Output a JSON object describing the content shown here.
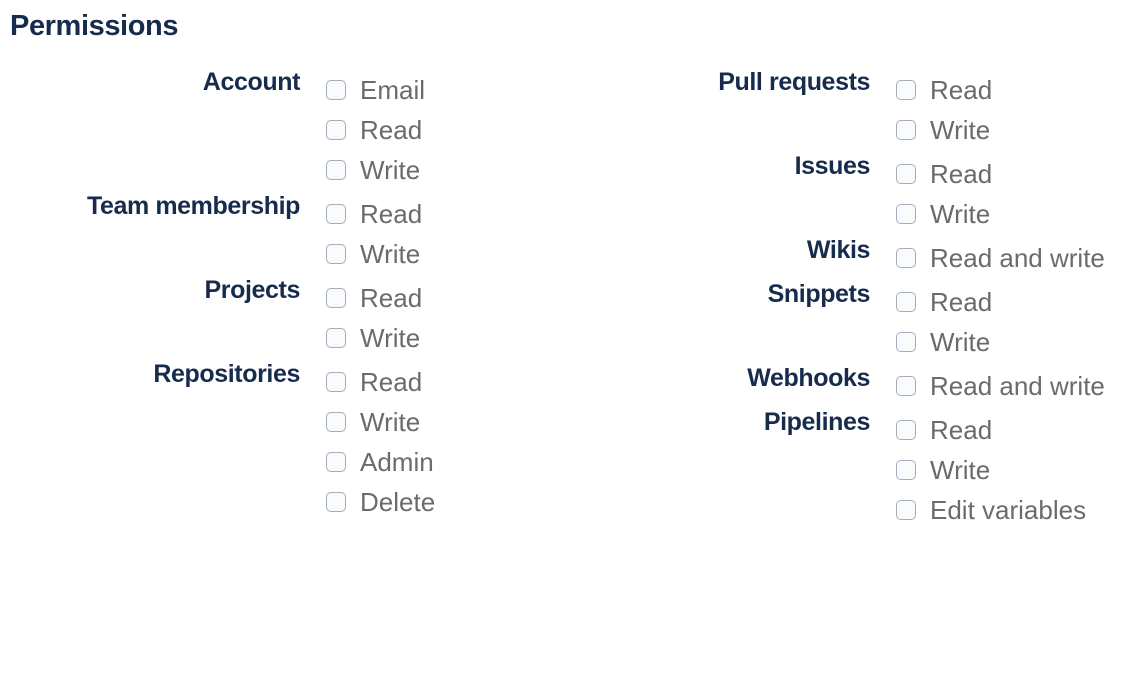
{
  "title": "Permissions",
  "left_groups": [
    {
      "label": "Account",
      "options": [
        "Email",
        "Read",
        "Write"
      ]
    },
    {
      "label": "Team membership",
      "options": [
        "Read",
        "Write"
      ]
    },
    {
      "label": "Projects",
      "options": [
        "Read",
        "Write"
      ]
    },
    {
      "label": "Repositories",
      "options": [
        "Read",
        "Write",
        "Admin",
        "Delete"
      ]
    }
  ],
  "right_groups": [
    {
      "label": "Pull requests",
      "options": [
        "Read",
        "Write"
      ]
    },
    {
      "label": "Issues",
      "options": [
        "Read",
        "Write"
      ]
    },
    {
      "label": "Wikis",
      "options": [
        "Read and write"
      ]
    },
    {
      "label": "Snippets",
      "options": [
        "Read",
        "Write"
      ]
    },
    {
      "label": "Webhooks",
      "options": [
        "Read and write"
      ]
    },
    {
      "label": "Pipelines",
      "options": [
        "Read",
        "Write",
        "Edit variables"
      ]
    }
  ],
  "checked": false,
  "colors": {
    "heading": "#172b4d",
    "option_text": "#6b6b6b",
    "checkbox_border": "#a5adba"
  }
}
